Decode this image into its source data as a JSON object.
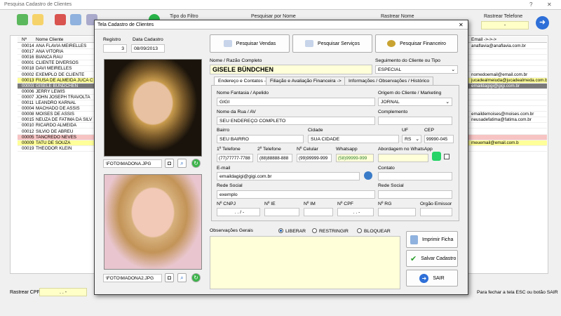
{
  "main": {
    "title": "Pesquisa Cadastro de Clientes",
    "help": "?",
    "close": "✕",
    "filters": {
      "tipo_label": "Tipo do Filtro",
      "pesquisar_label": "Pesquisar por Nome",
      "rastrear_nome_label": "Rastrear Nome",
      "rastrear_tel_label": "Rastrear Telefone",
      "rastrear_tel_value": "-"
    },
    "grid": {
      "col_no": "Nº",
      "col_nome": "Nome Cliente",
      "col_email": "Email ->->->",
      "rows": [
        {
          "id": "00014",
          "nome": "ANA FLAVIA MEIRELLES",
          "email": "anaflavia@anaflavia.com.br",
          "style": "normal"
        },
        {
          "id": "00017",
          "nome": "ANA VITORIA",
          "email": "",
          "style": "normal"
        },
        {
          "id": "00016",
          "nome": "BIANCA RAU",
          "email": "",
          "style": "normal"
        },
        {
          "id": "00001",
          "nome": "CLIENTE DIVERSOS",
          "email": "",
          "style": "normal"
        },
        {
          "id": "00018",
          "nome": "DAVI MEIRELLES",
          "email": "",
          "style": "normal"
        },
        {
          "id": "00002",
          "nome": "EXEMPLO DE CLIENTE",
          "email": "nomedoemail@email.com.br",
          "style": "normal",
          "icon": true
        },
        {
          "id": "00013",
          "nome": "FIUSA DE ALMEIDA JUCA C",
          "email": "jucadealmeiuda@jucadealmeda.com.b",
          "style": "yellow",
          "icon": true
        },
        {
          "id": "00003",
          "nome": "GISELE BÜNDCHEN",
          "email": "emaildagigi@gigi.com.br",
          "style": "selected",
          "icon": true
        },
        {
          "id": "00006",
          "nome": "JERRY LEWIS",
          "email": "",
          "style": "normal",
          "icon": true
        },
        {
          "id": "00007",
          "nome": "JOHN JOSEPH TRAVOLTA",
          "email": "",
          "style": "normal"
        },
        {
          "id": "00011",
          "nome": "LEANDRO KARNAL",
          "email": "",
          "style": "normal"
        },
        {
          "id": "00004",
          "nome": "MACHADO DE ASSIS",
          "email": "",
          "style": "normal",
          "icon": true
        },
        {
          "id": "00008",
          "nome": "MOISES DE ASSIS",
          "email": "emaildemoises@moises.com.br",
          "style": "normal"
        },
        {
          "id": "00015",
          "nome": "NEUZA DE FATIMA DA SILV",
          "email": "neusadefatima@fatima.com.br",
          "style": "normal"
        },
        {
          "id": "00010",
          "nome": "RICARDO ALMEIDA",
          "email": "",
          "style": "normal"
        },
        {
          "id": "00012",
          "nome": "SILVIO DE ABREU",
          "email": "",
          "style": "normal"
        },
        {
          "id": "00005",
          "nome": "TANCREDO NEVES",
          "email": "",
          "style": "pink"
        },
        {
          "id": "00009",
          "nome": "TATU DE SOUZA",
          "email": "meuemail@email.com.b",
          "style": "yellow"
        },
        {
          "id": "00019",
          "nome": "THEODOR KLEIN",
          "email": "",
          "style": "normal"
        }
      ]
    },
    "footer": {
      "rastrear_cpf_label": "Rastrear CPF",
      "rastrear_cpf_value": ". . -",
      "hint": "Para fechar a tela ESC ou botão SAIR"
    }
  },
  "dialog": {
    "title": "Tela Cadastro de Clientes",
    "close": "✕",
    "registro_label": "Registro",
    "registro_value": "3",
    "data_cadastro_label": "Data Cadastro",
    "data_cadastro_value": "08/09/2013",
    "btn_vendas": "Pesquisar Vendas",
    "btn_servicos": "Pesquisar Serviços",
    "btn_financeiro": "Pesquisar  Financeiro",
    "nome_label": "Nome / Razão Completo",
    "nome_value": "GISELE BÜNDCHEN",
    "seguimento_label": "Seguimento do Cliente ou Tipo",
    "seguimento_value": "ESPECIAL",
    "tabs": [
      "Endereço e Contatos ->",
      "Filiação e Avaliação Financeira ->",
      "Informações / Observações / Histórico"
    ],
    "fantasia_label": "Nome Fantasia / Apelido",
    "fantasia_value": "GIGI",
    "origem_label": "Origem do Cliente / Marketing",
    "origem_value": "JORNAL",
    "rua_label": "Nome da Rua / AV",
    "rua_value": "SEU ENDEREÇO COMPLETO",
    "complemento_label": "Complemento",
    "bairro_label": "Bairro",
    "bairro_value": "SEU BAIRRO",
    "cidade_label": "Cidade",
    "cidade_value": "SUA CIDADE",
    "uf_label": "UF",
    "uf_value": "RS",
    "cep_label": "CEP",
    "cep_value": "99990-045",
    "tel1_label": "1º Telefone",
    "tel1_value": "(77)77777-7788",
    "tel2_label": "2º Telefone",
    "tel2_value": "(88)88888-888",
    "cel_label": "Nº Celular",
    "cel_value": "(99)99999-999",
    "whats_label": "Whatsapp",
    "whats_value": "(58)99999-999",
    "abordagem_label": "Abordagem no WhatsApp",
    "email_label": "E-mail",
    "email_value": "emaildagigi@gigi.com.br",
    "contato_label": "Contato",
    "rede_label": "Rede Social",
    "rede_value": "exemplo",
    "rede2_label": "Rede Social",
    "cnpj_label": "Nº CNPJ",
    "cnpj_value": ". . / -",
    "ie_label": "Nº IE",
    "im_label": "Nº IM",
    "cpf_label": "Nº CPF",
    "cpf_value": ". . -",
    "rg_label": "Nº RG",
    "orgao_label": "Orgão Emissor",
    "obs_label": "Observações Gerais",
    "radio_liberar": "LIBERAR",
    "radio_restringir": "RESTRINGIR",
    "radio_bloquear": "BLOQUEAR",
    "foto1_path": "\\FOTO\\MADONA.JPG",
    "foto2_path": "\\FOTO\\MADONA2.JPG",
    "btn_imprimir": "Imprimir Ficha",
    "btn_salvar": "Salvar Cadastro",
    "btn_sair": "SAIR",
    "colors": {
      "accent": "#ffffd9",
      "whats": "#25d366",
      "selected_row": "#7a7a7a"
    }
  }
}
